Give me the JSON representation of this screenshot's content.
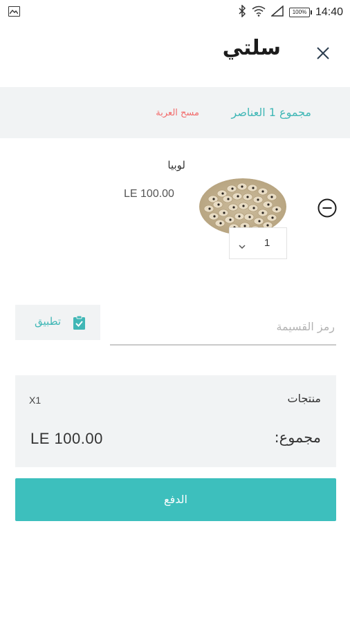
{
  "status_bar": {
    "time": "14:40",
    "battery": "100%",
    "icons": [
      "image-icon",
      "bluetooth-icon",
      "wifi-icon",
      "signal-icon",
      "battery-icon"
    ]
  },
  "header": {
    "title": "سلتي",
    "close_icon": "close-icon"
  },
  "summary": {
    "count_text": "مجموع  1 العناصر",
    "clear_label": "مسح العربة"
  },
  "cart_items": [
    {
      "name": "لوبيا",
      "price": "LE 100.00",
      "quantity": "1",
      "image": "black-eyed-peas"
    }
  ],
  "coupon": {
    "placeholder": "رمز القسيمة",
    "value": "",
    "apply_label": "تطبيق"
  },
  "totals": {
    "products_label": "منتجات",
    "products_qty": "X1",
    "total_label": "مجموع:",
    "total_value": "LE 100.00"
  },
  "checkout": {
    "label": "الدفع"
  },
  "colors": {
    "accent": "#3dbfbd",
    "accent_text": "#40b7b6",
    "danger": "#f26b6b",
    "panel": "#f1f3f4"
  }
}
